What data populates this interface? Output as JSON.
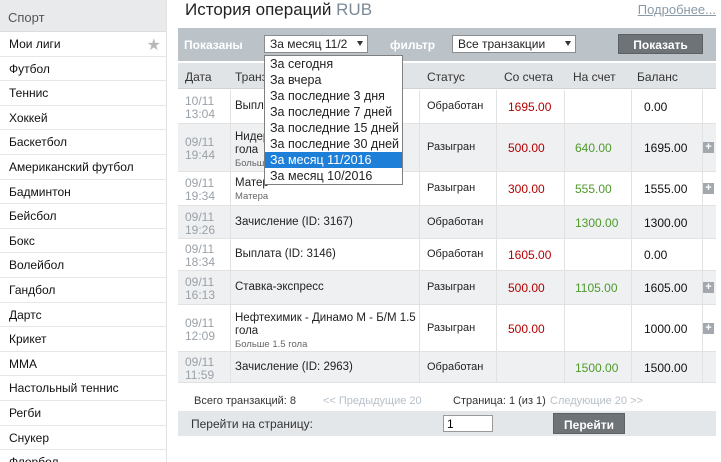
{
  "sidebar": {
    "header": "Спорт",
    "items": [
      {
        "label": "Мои лиги",
        "star": true
      },
      {
        "label": "Футбол"
      },
      {
        "label": "Теннис"
      },
      {
        "label": "Хоккей"
      },
      {
        "label": "Баскетбол"
      },
      {
        "label": "Американский футбол"
      },
      {
        "label": "Бадминтон"
      },
      {
        "label": "Бейсбол"
      },
      {
        "label": "Бокс"
      },
      {
        "label": "Волейбол"
      },
      {
        "label": "Гандбол"
      },
      {
        "label": "Дартс"
      },
      {
        "label": "Крикет"
      },
      {
        "label": "MMA"
      },
      {
        "label": "Настольный теннис"
      },
      {
        "label": "Регби"
      },
      {
        "label": "Снукер"
      },
      {
        "label": "Флорбол"
      }
    ]
  },
  "header": {
    "title": "История операций",
    "currency": "RUB",
    "more_link": "Подробнее..."
  },
  "filters": {
    "shown_label": "Показаны",
    "period_value": "За месяц 11/2",
    "filter_label": "фильтр",
    "filter_value": "Все транзакции",
    "show_button": "Показать"
  },
  "dropdown": {
    "options": [
      "За сегодня",
      "За вчера",
      "За последние 3 дня",
      "За последние 7 дней",
      "За последние 15 дней",
      "За последние 30 дней",
      "За месяц 11/2016",
      "За месяц 10/2016"
    ],
    "selected": "За месяц 11/2016"
  },
  "table": {
    "columns": {
      "date": "Дата",
      "trans": "Транз",
      "status": "Статус",
      "from": "Со счета",
      "to": "На счет",
      "balance": "Баланс"
    },
    "rows": [
      {
        "d1": "10/11",
        "d2": "13:04",
        "desc": "Выпла",
        "sub": "",
        "status": "Обработан",
        "from": "1695.00",
        "to": "",
        "balance": "0.00",
        "plus": false
      },
      {
        "d1": "09/11",
        "d2": "19:44",
        "desc": "Нидер",
        "desc2": "гола",
        "sub": "Больше",
        "status": "Разыгран",
        "from": "500.00",
        "to": "640.00",
        "balance": "1695.00",
        "plus": true
      },
      {
        "d1": "09/11",
        "d2": "19:34",
        "desc": "Матер",
        "sub": "Матера",
        "status": "Разыгран",
        "from": "300.00",
        "to": "555.00",
        "balance": "1555.00",
        "plus": true
      },
      {
        "d1": "09/11",
        "d2": "19:26",
        "desc": "Зачисление (ID: 3167)",
        "sub": "",
        "status": "Обработан",
        "from": "",
        "to": "1300.00",
        "balance": "1300.00",
        "plus": false
      },
      {
        "d1": "09/11",
        "d2": "18:34",
        "desc": "Выплата (ID: 3146)",
        "sub": "",
        "status": "Обработан",
        "from": "1605.00",
        "to": "",
        "balance": "0.00",
        "plus": false
      },
      {
        "d1": "09/11",
        "d2": "16:13",
        "desc": "Ставка-экспресс",
        "sub": "",
        "status": "Разыгран",
        "from": "500.00",
        "to": "1105.00",
        "balance": "1605.00",
        "plus": true
      },
      {
        "d1": "09/11",
        "d2": "12:09",
        "desc": "Нефтехимик - Динамо М - Б/М 1.5",
        "desc2": "гола",
        "sub": "Больше 1.5 гола",
        "status": "Разыгран",
        "from": "500.00",
        "to": "",
        "balance": "1000.00",
        "plus": true
      },
      {
        "d1": "09/11",
        "d2": "11:59",
        "desc": "Зачисление (ID: 2963)",
        "sub": "",
        "status": "Обработан",
        "from": "",
        "to": "1500.00",
        "balance": "1500.00",
        "plus": false
      }
    ]
  },
  "footer": {
    "total": "Всего транзакций: 8",
    "prev": "<< Предыдущие 20",
    "page": "Страница: 1 (из 1)",
    "next": "Следующие 20 >>",
    "goto_label": "Перейти на страницу:",
    "goto_value": "1",
    "goto_button": "Перейти"
  }
}
